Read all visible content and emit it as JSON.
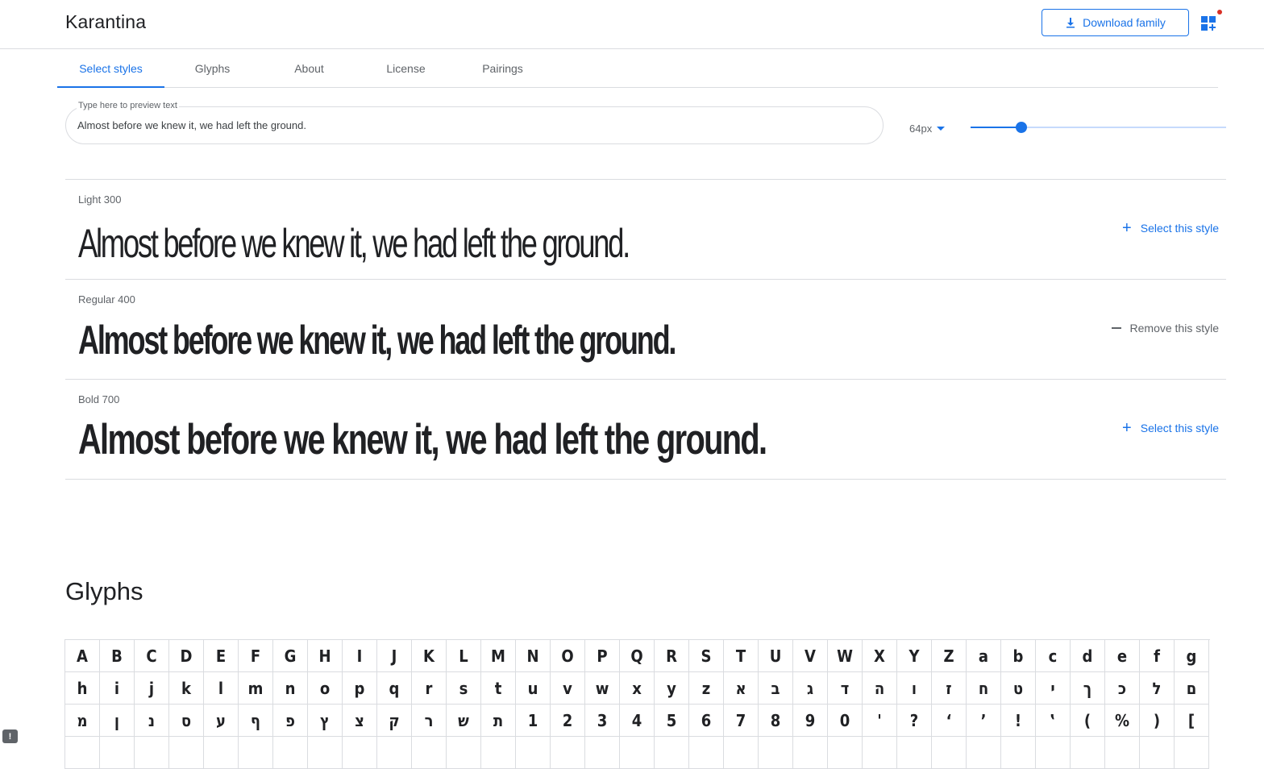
{
  "header": {
    "family_name": "Karantina",
    "download_label": "Download family",
    "download_icon": "download-icon",
    "collection_icon": "add-to-collection-icon"
  },
  "tabs": [
    {
      "label": "Select styles",
      "active": true
    },
    {
      "label": "Glyphs",
      "active": false
    },
    {
      "label": "About",
      "active": false
    },
    {
      "label": "License",
      "active": false
    },
    {
      "label": "Pairings",
      "active": false
    }
  ],
  "preview": {
    "label": "Type here to preview text",
    "value": "Almost before we knew it, we had left the ground.",
    "size_label": "64px",
    "size_value": 64,
    "slider_fraction": 0.2
  },
  "styles": [
    {
      "name": "Light 300",
      "sample": "Almost before we knew it, we had left the ground.",
      "action": "Select this style"
    },
    {
      "name": "Regular 400",
      "sample": "Almost before we knew it, we had left the ground.",
      "action": "Remove this style"
    },
    {
      "name": "Bold 700",
      "sample": "Almost before we knew it, we had left the ground.",
      "action": "Select this style"
    }
  ],
  "glyphs": {
    "heading": "Glyphs",
    "rows": [
      [
        "A",
        "B",
        "C",
        "D",
        "E",
        "F",
        "G",
        "H",
        "I",
        "J",
        "K",
        "L",
        "M",
        "N",
        "O",
        "P",
        "Q",
        "R",
        "S",
        "T",
        "U",
        "V",
        "W",
        "X",
        "Y",
        "Z",
        "a",
        "b",
        "c",
        "d",
        "e",
        "f",
        "g"
      ],
      [
        "h",
        "i",
        "j",
        "k",
        "l",
        "m",
        "n",
        "o",
        "p",
        "q",
        "r",
        "s",
        "t",
        "u",
        "v",
        "w",
        "x",
        "y",
        "z",
        "א",
        "ב",
        "ג",
        "ד",
        "ה",
        "ו",
        "ז",
        "ח",
        "ט",
        "י",
        "ך",
        "כ",
        "ל",
        "ם"
      ],
      [
        "מ",
        "ן",
        "נ",
        "ס",
        "ע",
        "ף",
        "פ",
        "ץ",
        "צ",
        "ק",
        "ר",
        "ש",
        "ת",
        "1",
        "2",
        "3",
        "4",
        "5",
        "6",
        "7",
        "8",
        "9",
        "0",
        "'",
        "?",
        "‘",
        "’",
        "!",
        "‛",
        "(",
        "%",
        ")",
        "["
      ]
    ]
  },
  "colors": {
    "accent": "#1a73e8",
    "text": "#202124",
    "muted": "#5f6368",
    "divider": "#dadce0"
  }
}
